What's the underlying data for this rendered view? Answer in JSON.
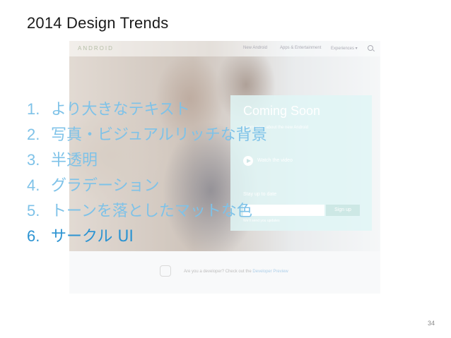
{
  "slide": {
    "title": "2014 Design Trends",
    "page_number": "34"
  },
  "background_screenshot": {
    "logo": "ANDROID",
    "nav": [
      "New Android",
      "Apps & Entertainment",
      "Experiences ▾"
    ],
    "panel": {
      "title": "Coming Soon",
      "subtitle": "Learn more about the new Android",
      "video_label": "Watch the video",
      "signup_label": "Stay up to date",
      "email_placeholder": "",
      "signup_button": "Sign up",
      "note": "We’ll send you updates"
    },
    "footer_text": "Are you a developer? Check out the",
    "footer_link": "Developer Preview"
  },
  "trends": [
    {
      "number": "1.",
      "text": "より大きなテキスト",
      "active": false
    },
    {
      "number": "2.",
      "text": "写真・ビジュアルリッチな背景",
      "active": false
    },
    {
      "number": "3.",
      "text": "半透明",
      "active": false
    },
    {
      "number": "4.",
      "text": "グラデーション",
      "active": false
    },
    {
      "number": "5.",
      "text": "トーンを落としたマットな色",
      "active": false
    },
    {
      "number": "6.",
      "text": "サークル UI",
      "active": true
    }
  ],
  "colors": {
    "trend_text": "#7ec2e8",
    "trend_active": "#2b93d2",
    "panel": "#c8eeee"
  }
}
